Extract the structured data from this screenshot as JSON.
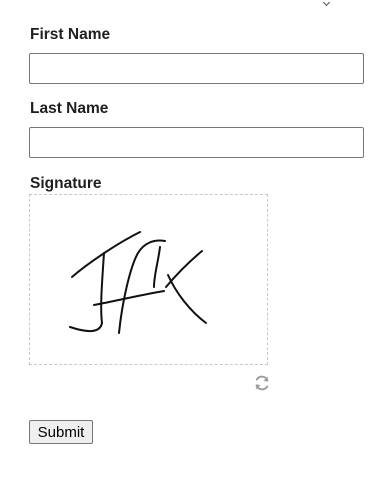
{
  "form": {
    "first_name_label": "First Name",
    "first_name_value": "",
    "last_name_label": "Last Name",
    "last_name_value": "",
    "signature_label": "Signature",
    "signature_text": "JFK",
    "submit_label": "Submit"
  },
  "icons": {
    "refresh": "refresh-icon",
    "top_mark": "chevron-down-icon"
  },
  "colors": {
    "input_border": "#767676",
    "pad_border": "#c8c8c8",
    "icon": "#9e9e9e",
    "button_bg": "#efefef"
  }
}
